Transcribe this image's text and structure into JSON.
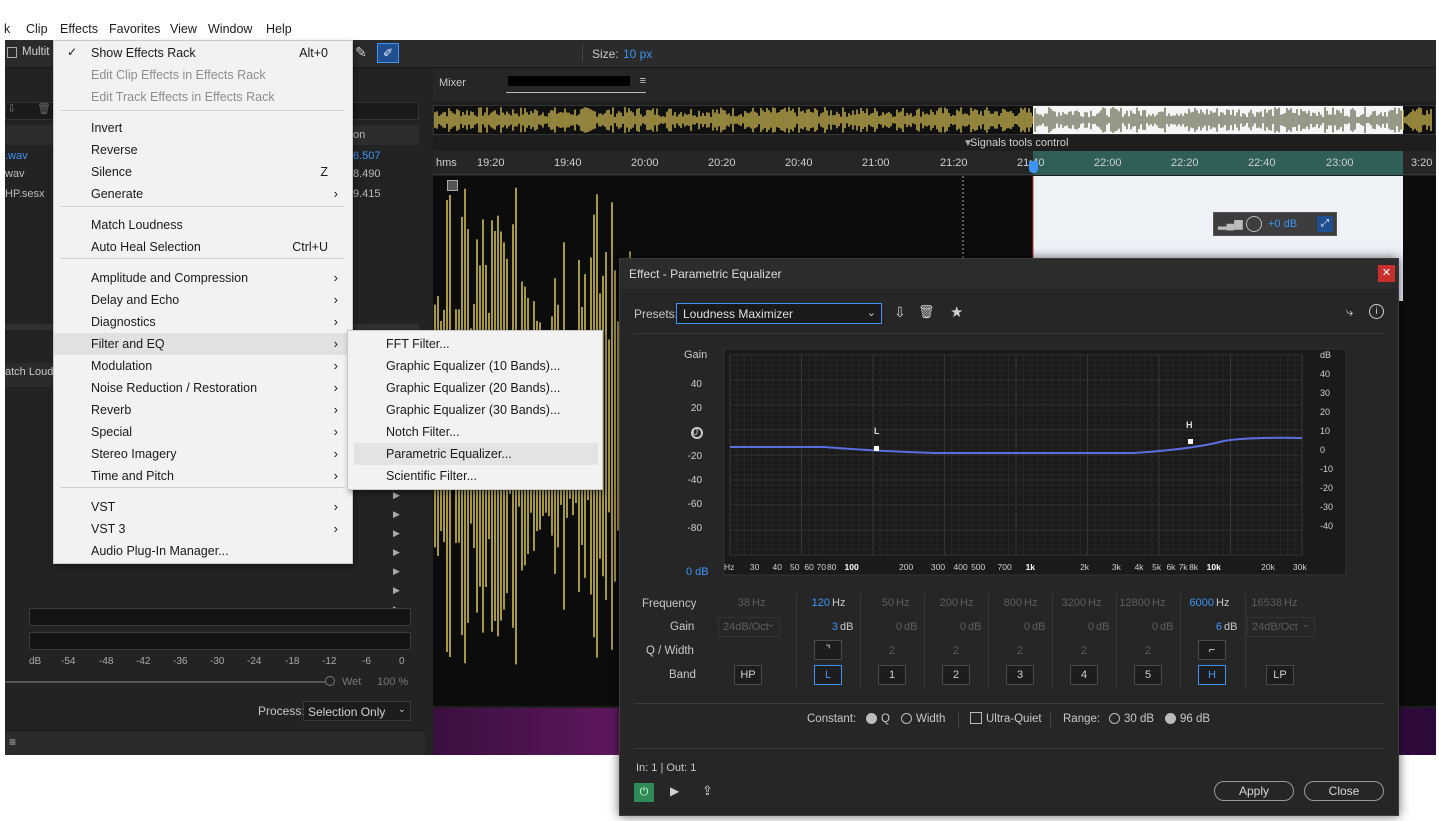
{
  "menubar": {
    "items": [
      "k",
      "Clip",
      "Effects",
      "Favorites",
      "View",
      "Window",
      "Help"
    ]
  },
  "toolbar": {
    "workspace_label": "Multit",
    "size_label": "Size:",
    "size_value": "10 px"
  },
  "left_panel": {
    "files": [
      {
        "name": ".wav",
        "duration": "6.507"
      },
      {
        "name": "wav",
        "duration": "8.490"
      },
      {
        "name": "HP.sesx",
        "duration": "9.415"
      }
    ],
    "column_header": "on",
    "rack_label": "atch Loud",
    "meter_ticks": [
      "dB",
      "-54",
      "-48",
      "-42",
      "-36",
      "-30",
      "-24",
      "-18",
      "-12",
      "-6",
      "0"
    ],
    "wet_label": "Wet",
    "wet_value": "100 %",
    "process_label": "Process:",
    "process_value": "Selection Only"
  },
  "editor": {
    "mixer_label": "Mixer",
    "signals_label": "Signals tools control",
    "time_unit": "hms",
    "time_ticks": [
      "19:20",
      "19:40",
      "20:00",
      "20:20",
      "20:40",
      "21:00",
      "21:20",
      "21:40",
      "22:00",
      "22:20",
      "22:40",
      "23:00",
      "3:20"
    ],
    "hud_gain": "+0 dB"
  },
  "effects_menu": {
    "items": [
      {
        "label": "Show Effects Rack",
        "shortcut": "Alt+0",
        "checked": true
      },
      {
        "label": "Edit Clip Effects in Effects Rack",
        "disabled": true
      },
      {
        "label": "Edit Track Effects in Effects Rack",
        "disabled": true
      },
      {
        "label": "Invert"
      },
      {
        "label": "Reverse"
      },
      {
        "label": "Silence",
        "shortcut": "Z"
      },
      {
        "label": "Generate",
        "submenu": true
      },
      {
        "label": "Match Loudness"
      },
      {
        "label": "Auto Heal Selection",
        "shortcut": "Ctrl+U"
      },
      {
        "label": "Amplitude and Compression",
        "submenu": true
      },
      {
        "label": "Delay and Echo",
        "submenu": true
      },
      {
        "label": "Diagnostics",
        "submenu": true
      },
      {
        "label": "Filter and EQ",
        "submenu": true,
        "highlighted": true
      },
      {
        "label": "Modulation",
        "submenu": true
      },
      {
        "label": "Noise Reduction / Restoration",
        "submenu": true
      },
      {
        "label": "Reverb",
        "submenu": true
      },
      {
        "label": "Special",
        "submenu": true
      },
      {
        "label": "Stereo Imagery",
        "submenu": true
      },
      {
        "label": "Time and Pitch",
        "submenu": true
      },
      {
        "label": "VST",
        "submenu": true
      },
      {
        "label": "VST 3",
        "submenu": true
      },
      {
        "label": "Audio Plug-In Manager..."
      }
    ]
  },
  "submenu": {
    "items": [
      {
        "label": "FFT Filter..."
      },
      {
        "label": "Graphic Equalizer (10 Bands)..."
      },
      {
        "label": "Graphic Equalizer (20 Bands)..."
      },
      {
        "label": "Graphic Equalizer (30 Bands)..."
      },
      {
        "label": "Notch Filter..."
      },
      {
        "label": "Parametric Equalizer...",
        "highlighted": true
      },
      {
        "label": "Scientific Filter..."
      }
    ]
  },
  "dialog": {
    "title": "Effect - Parametric Equalizer",
    "presets_label": "Presets:",
    "preset_value": "Loudness Maximizer",
    "gain_label": "Gain",
    "gain_ticks": [
      "40",
      "20",
      "0",
      "-20",
      "-40",
      "-60",
      "-80"
    ],
    "db_ticks": [
      "dB",
      "40",
      "30",
      "20",
      "10",
      "0",
      "-10",
      "-20",
      "-30",
      "-40"
    ],
    "zero_db_label": "0 dB",
    "freq_ticks": [
      "Hz",
      "30",
      "40",
      "50",
      "60",
      "70",
      "80",
      "100",
      "200",
      "300",
      "400",
      "500",
      "700",
      "1k",
      "2k",
      "3k",
      "4k",
      "5k",
      "6k",
      "7k",
      "8k",
      "10k",
      "20k",
      "30k"
    ],
    "marker_l": "L",
    "marker_h": "H",
    "row_labels": {
      "frequency": "Frequency",
      "gain": "Gain",
      "q_width": "Q / Width",
      "band": "Band"
    },
    "bands": [
      {
        "freq_num": "38",
        "freq_unit": "Hz",
        "gain": "24dB/Oct",
        "q": "",
        "band": "HP",
        "active": false
      },
      {
        "freq_num": "120",
        "freq_unit": "Hz",
        "gain": "3",
        "gain_unit": "dB",
        "q": "shelf-low",
        "band": "L",
        "active": true
      },
      {
        "freq_num": "50",
        "freq_unit": "Hz",
        "gain": "0",
        "gain_unit": "dB",
        "q": "2",
        "band": "1",
        "active": false
      },
      {
        "freq_num": "200",
        "freq_unit": "Hz",
        "gain": "0",
        "gain_unit": "dB",
        "q": "2",
        "band": "2",
        "active": false
      },
      {
        "freq_num": "800",
        "freq_unit": "Hz",
        "gain": "0",
        "gain_unit": "dB",
        "q": "2",
        "band": "3",
        "active": false
      },
      {
        "freq_num": "3200",
        "freq_unit": "Hz",
        "gain": "0",
        "gain_unit": "dB",
        "q": "2",
        "band": "4",
        "active": false
      },
      {
        "freq_num": "12800",
        "freq_unit": "Hz",
        "gain": "0",
        "gain_unit": "dB",
        "q": "2",
        "band": "5",
        "active": false
      },
      {
        "freq_num": "6000",
        "freq_unit": "Hz",
        "gain": "6",
        "gain_unit": "dB",
        "q": "shelf-high",
        "band": "H",
        "active": true
      },
      {
        "freq_num": "16538",
        "freq_unit": "Hz",
        "gain": "24dB/Oct",
        "q": "",
        "band": "LP",
        "active": false
      }
    ],
    "constant_label": "Constant:",
    "q_option": "Q",
    "width_option": "Width",
    "ultra_quiet": "Ultra-Quiet",
    "range_label": "Range:",
    "range_30": "30 dB",
    "range_96": "96 dB",
    "io_label": "In: 1 | Out: 1",
    "apply_label": "Apply",
    "close_label": "Close"
  },
  "colors": {
    "accent_blue": "#3d94f6",
    "waveform_yellow": "#e9d35a",
    "curve_blue": "#5a6ee0",
    "close_red": "#c9302c",
    "power_green": "#2e8b57"
  }
}
